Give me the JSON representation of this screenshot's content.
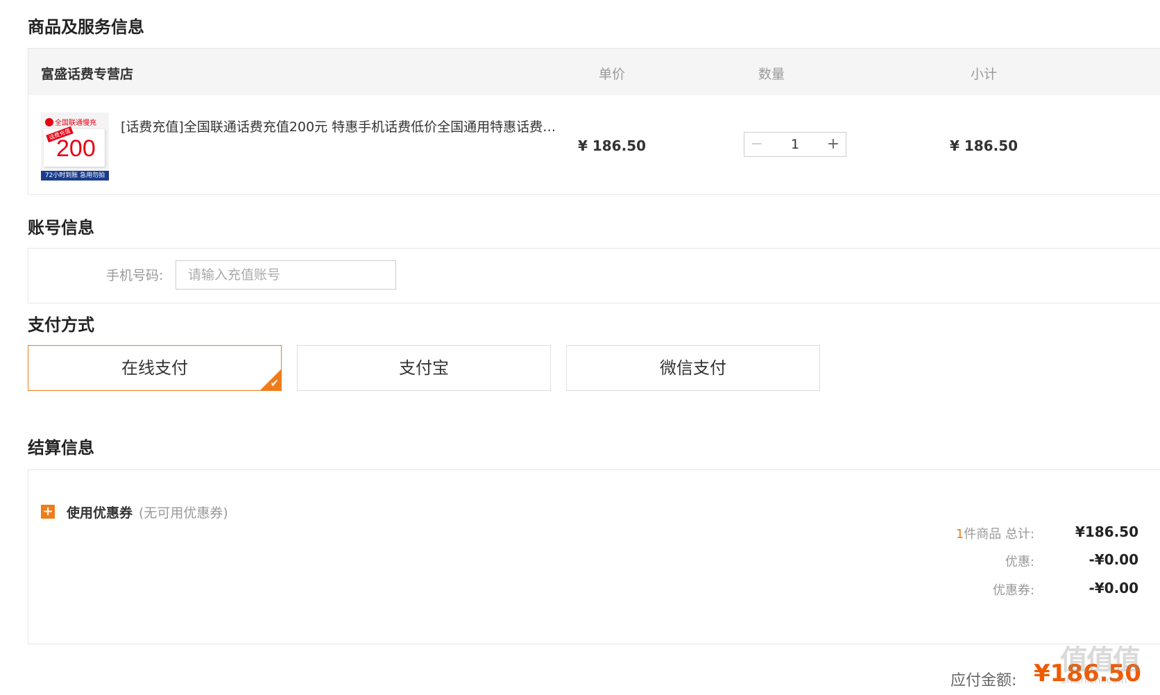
{
  "sections": {
    "product": "商品及服务信息",
    "account": "账号信息",
    "payment": "支付方式",
    "settlement": "结算信息"
  },
  "table": {
    "shop_name": "富盛话费专营店",
    "col_price": "单价",
    "col_qty": "数量",
    "col_subtotal": "小计"
  },
  "item": {
    "thumb_brand": "全国联通慢充",
    "thumb_tag": "话费充值",
    "thumb_value": "200",
    "thumb_strip": "72小时到账 急用勿拍",
    "name": "[话费充值]全国联通话费充值200元 特惠手机话费低价全国通用特惠话费…",
    "unit_price": "¥ 186.50",
    "qty": "1",
    "minus": "−",
    "plus": "+",
    "subtotal": "¥ 186.50"
  },
  "account": {
    "label": "手机号码:",
    "placeholder": "请输入充值账号"
  },
  "payment": {
    "options": [
      "在线支付",
      "支付宝",
      "微信支付"
    ],
    "selected_index": 0,
    "check": "✔"
  },
  "settlement": {
    "coupon_label": "使用优惠券",
    "coupon_note": "(无可用优惠券)",
    "count": "1",
    "count_suffix": "件商品  总计:",
    "total": "¥186.50",
    "discount_label": "优惠:",
    "discount": "-¥0.00",
    "coupon_row_label": "优惠券:",
    "coupon_value": "-¥0.00",
    "payable_label": "应付金额:",
    "payable": "¥186.50"
  },
  "watermark": {
    "main": "值值值",
    "sub": "zhizhizhi.com"
  },
  "colors": {
    "accent": "#f07c1a",
    "payable": "#f05a00",
    "header_bg": "#f5f5f5"
  }
}
